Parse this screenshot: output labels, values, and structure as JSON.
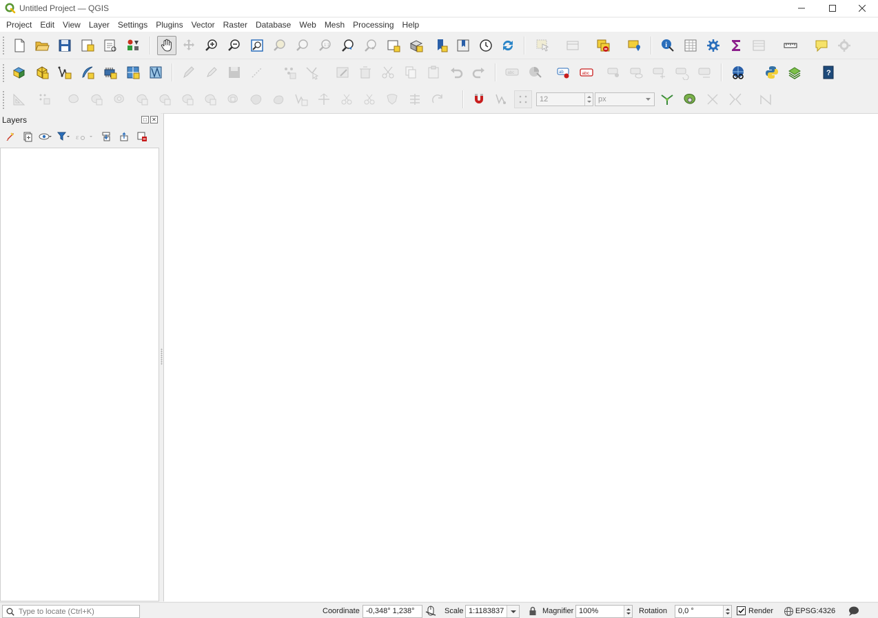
{
  "window": {
    "title": "Untitled Project — QGIS",
    "brand_color": "#589632"
  },
  "menu": [
    {
      "label": "Project"
    },
    {
      "label": "Edit"
    },
    {
      "label": "View"
    },
    {
      "label": "Layer"
    },
    {
      "label": "Settings"
    },
    {
      "label": "Plugins"
    },
    {
      "label": "Vector"
    },
    {
      "label": "Raster"
    },
    {
      "label": "Database"
    },
    {
      "label": "Web"
    },
    {
      "label": "Mesh"
    },
    {
      "label": "Processing"
    },
    {
      "label": "Help"
    }
  ],
  "snapping": {
    "tolerance_value": "12",
    "unit": "px"
  },
  "layers_panel": {
    "title": "Layers"
  },
  "statusbar": {
    "locator_placeholder": "Type to locate (Ctrl+K)",
    "coordinate_label": "Coordinate",
    "coordinate_value": "-0,348° 1,238°",
    "scale_label": "Scale",
    "scale_value": "1:1183837",
    "magnifier_label": "Magnifier",
    "magnifier_value": "100%",
    "rotation_label": "Rotation",
    "rotation_value": "0,0 °",
    "render_label": "Render",
    "render_checked": true,
    "crs_label": "EPSG:4326"
  },
  "colors": {
    "accent_blue": "#2a6ebb",
    "accent_yellow": "#f2cf3a",
    "accent_red": "#c81e1e",
    "python_blue": "#3572a5"
  }
}
